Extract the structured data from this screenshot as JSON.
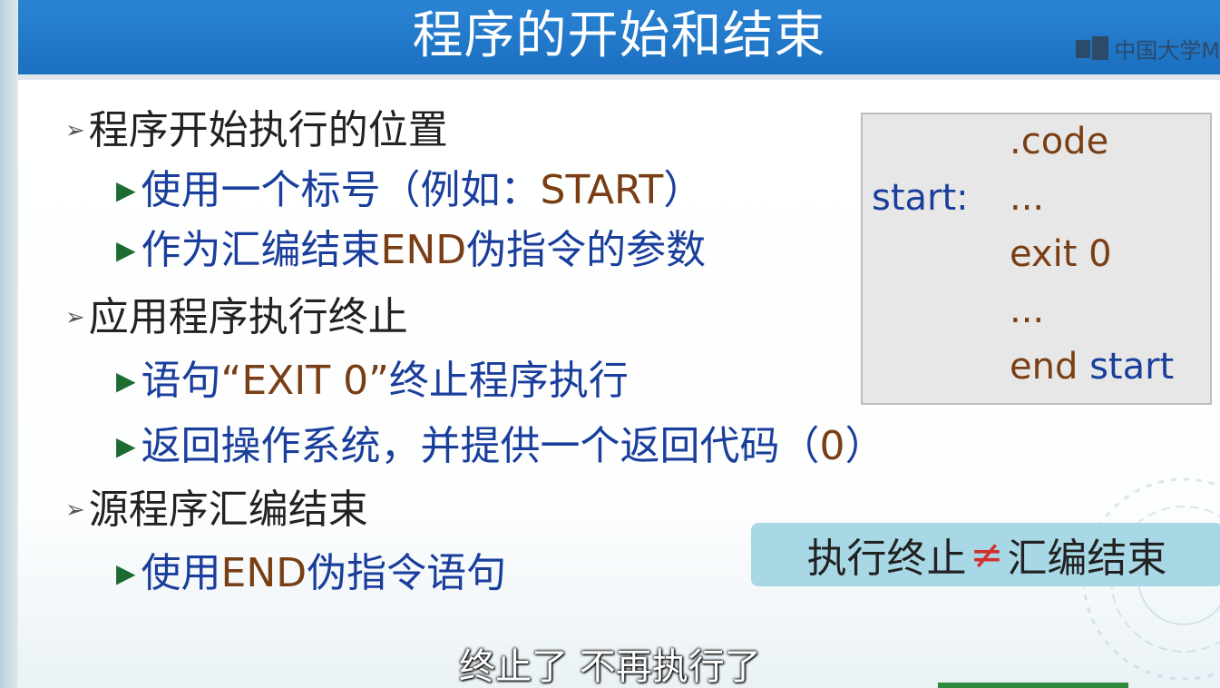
{
  "header": {
    "title": "程序的开始和结束",
    "logo_text": "中国大学M"
  },
  "bullets": [
    {
      "text": "程序开始执行的位置",
      "sub": [
        {
          "parts": [
            "使用一个标号（例如：",
            "START",
            "）"
          ]
        },
        {
          "parts": [
            "作为汇编结束",
            "END",
            "伪指令的参数"
          ]
        }
      ]
    },
    {
      "text": "应用程序执行终止",
      "sub": [
        {
          "parts": [
            "语句",
            "“EXIT 0”",
            "终止程序执行"
          ]
        },
        {
          "parts": [
            "返回操作系统，并提供一个返回代码（",
            "0",
            "）"
          ]
        }
      ]
    },
    {
      "text": "源程序汇编结束",
      "sub": [
        {
          "parts": [
            "使用",
            "END",
            "伪指令语句"
          ]
        }
      ]
    }
  ],
  "code_box": {
    "label": "start:",
    "lines": [
      ".code",
      "...",
      "exit 0",
      "...",
      "end",
      "start"
    ]
  },
  "note": {
    "left": "执行终止",
    "symbol": "≠",
    "right": "汇编结束"
  },
  "subtitle": "终止了 不再执行了"
}
